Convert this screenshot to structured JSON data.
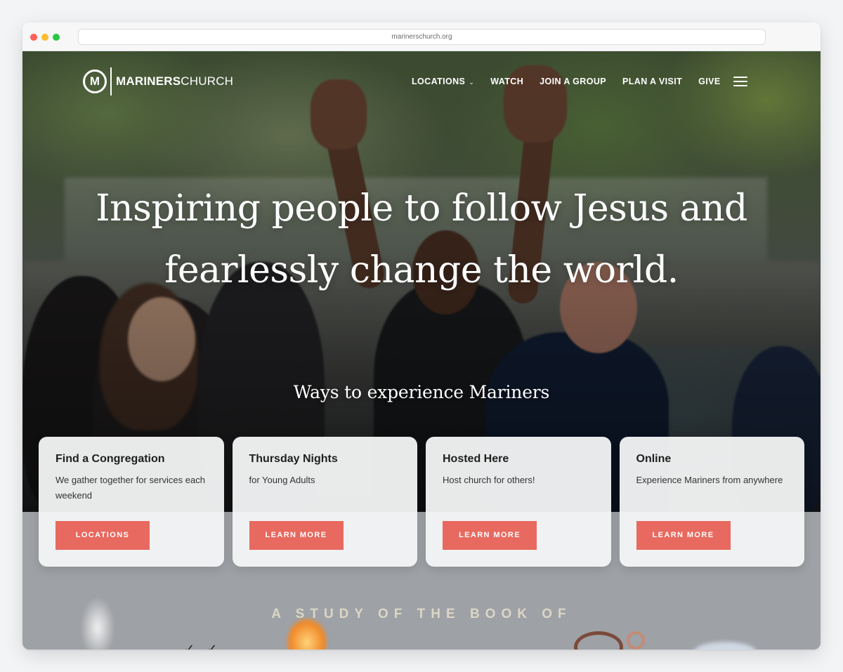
{
  "browser": {
    "url": "marinerschurch.org"
  },
  "brand": {
    "logo_letter": "M",
    "name_bold": "MARINERS",
    "name_light": "CHURCH"
  },
  "nav": {
    "items": [
      {
        "label": "LOCATIONS",
        "has_dropdown": true
      },
      {
        "label": "WATCH"
      },
      {
        "label": "JOIN A GROUP"
      },
      {
        "label": "PLAN A VISIT"
      },
      {
        "label": "GIVE"
      }
    ],
    "menu_icon": "hamburger-menu-icon",
    "dropdown_icon": "chevron-down-icon"
  },
  "hero": {
    "headline_line1": "Inspiring people to follow Jesus and",
    "headline_line2": "fearlessly change the world.",
    "subheading": "Ways to experience Mariners"
  },
  "cards": [
    {
      "title": "Find a Congregation",
      "description": "We gather together for services each weekend",
      "button": "LOCATIONS"
    },
    {
      "title": "Thursday Nights",
      "description": "for Young Adults",
      "button": "LEARN MORE"
    },
    {
      "title": "Hosted Here",
      "description": "Host church for others!",
      "button": "LEARN MORE"
    },
    {
      "title": "Online",
      "description": "Experience Mariners from anywhere",
      "button": "LEARN MORE"
    }
  ],
  "study": {
    "heading": "A STUDY OF THE BOOK OF"
  },
  "colors": {
    "accent_button": "#e8695f",
    "card_background": "#f4f5f5",
    "lower_section": "#9ea1a5"
  }
}
